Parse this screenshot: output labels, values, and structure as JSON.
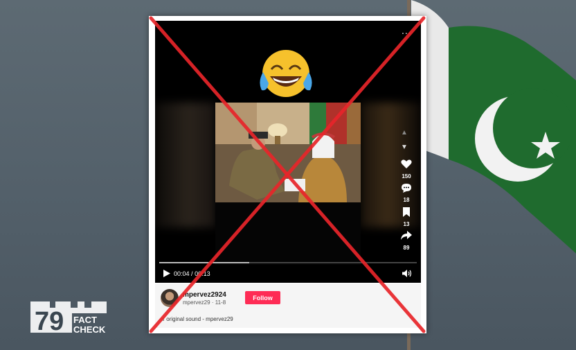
{
  "video": {
    "more_label": "...",
    "likes": "150",
    "comments": "18",
    "saves": "13",
    "shares": "89",
    "time_current": "00:04",
    "time_separator": "/",
    "time_total": "00:13",
    "progress": 0.35
  },
  "post": {
    "username": "mpervez2924",
    "handle": "mpervez29",
    "date": "11-8",
    "meta_separator": "·",
    "follow_label": "Follow",
    "sound_text": "original sound - mpervez29"
  },
  "icons": {
    "emoji": "face-with-tears-of-joy-icon",
    "like": "heart-icon",
    "comment": "comment-icon",
    "save": "bookmark-icon",
    "share": "share-icon",
    "play": "play-icon",
    "volume": "volume-icon"
  },
  "colors": {
    "follow_button": "#fe2c55",
    "cross_overlay": "#e8252a",
    "flag_green": "#1f6b2e",
    "flag_white": "#f2f2f2"
  }
}
